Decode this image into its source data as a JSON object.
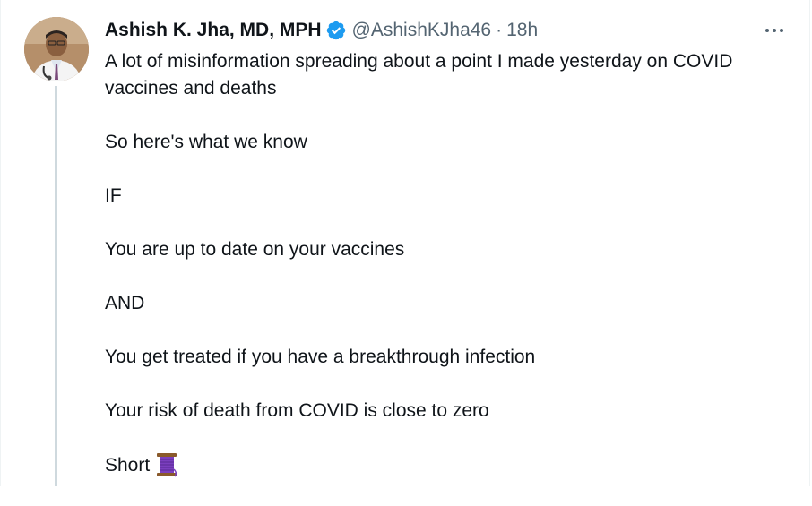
{
  "author": {
    "name": "Ashish K. Jha, MD, MPH",
    "handle": "@AshishKJha46",
    "separator": "·",
    "time": "18h",
    "verified_icon": "verified-badge-icon",
    "verified_color": "#1d9bf0"
  },
  "menu": {
    "icon": "more-options-icon"
  },
  "tweet": {
    "paragraphs": [
      "A lot of misinformation spreading about a point I made yesterday on COVID vaccines and deaths",
      "So here's what we know",
      "IF",
      "You are up to date on your vaccines",
      "AND",
      "You get treated if you have a breakthrough infection",
      "Your risk of death from COVID is close to zero",
      "Short"
    ],
    "trailing_emoji": "thread-spool-emoji"
  },
  "colors": {
    "text": "#0f1419",
    "secondary": "#536471",
    "thread_line": "#cfd9de"
  }
}
